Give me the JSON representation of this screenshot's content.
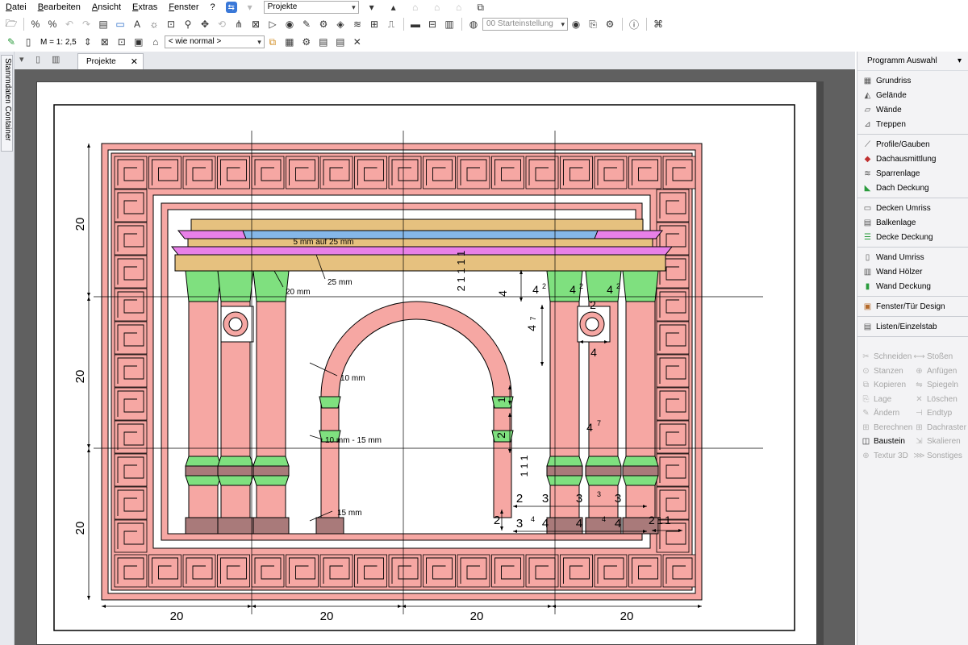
{
  "menu": {
    "items": [
      "Datei",
      "Bearbeiten",
      "Ansicht",
      "Extras",
      "Fenster",
      "?"
    ],
    "search_value": "Projekte"
  },
  "toolbar2": {
    "scale_label": "M = 1: 2,5",
    "line_style_value": "< wie normal >",
    "start_setting_value": "00 Starteinstellung"
  },
  "sidebar": {
    "stamm_label": "Stammdaten Container"
  },
  "tabs": {
    "active_label": "Projekte"
  },
  "right_panel": {
    "title": "Programm Auswahl",
    "groups": [
      [
        {
          "label": "Grundriss",
          "icon": "floorplan-icon"
        },
        {
          "label": "Gelände",
          "icon": "terrain-icon"
        },
        {
          "label": "Wände",
          "icon": "walls-icon"
        },
        {
          "label": "Treppen",
          "icon": "stairs-icon"
        }
      ],
      [
        {
          "label": "Profile/Gauben",
          "icon": "profile-icon"
        },
        {
          "label": "Dachausmittlung",
          "icon": "roof-icon"
        },
        {
          "label": "Sparrenlage",
          "icon": "rafter-icon"
        },
        {
          "label": "Dach Deckung",
          "icon": "roof-cover-icon"
        }
      ],
      [
        {
          "label": "Decken Umriss",
          "icon": "ceiling-outline-icon"
        },
        {
          "label": "Balkenlage",
          "icon": "beam-icon"
        },
        {
          "label": "Decke Deckung",
          "icon": "ceiling-cover-icon"
        }
      ],
      [
        {
          "label": "Wand Umriss",
          "icon": "wall-outline-icon"
        },
        {
          "label": "Wand Hölzer",
          "icon": "wall-timber-icon"
        },
        {
          "label": "Wand Deckung",
          "icon": "wall-cover-icon"
        }
      ],
      [
        {
          "label": "Fenster/Tür Design",
          "icon": "window-door-icon"
        }
      ],
      [
        {
          "label": "Listen/Einzelstab",
          "icon": "list-icon"
        }
      ]
    ],
    "tools": [
      {
        "label": "Schneiden",
        "active": false
      },
      {
        "label": "Stoßen",
        "active": false
      },
      {
        "label": "Stanzen",
        "active": false
      },
      {
        "label": "Anfügen",
        "active": false
      },
      {
        "label": "Kopieren",
        "active": false
      },
      {
        "label": "Spiegeln",
        "active": false
      },
      {
        "label": "Lage",
        "active": false
      },
      {
        "label": "Löschen",
        "active": false
      },
      {
        "label": "Ändern",
        "active": false
      },
      {
        "label": "Endtyp",
        "active": false
      },
      {
        "label": "Berechnen",
        "active": false
      },
      {
        "label": "Dachraster",
        "active": false
      },
      {
        "label": "Baustein",
        "active": true
      },
      {
        "label": "Skalieren",
        "active": false
      },
      {
        "label": "Textur 3D",
        "active": false
      },
      {
        "label": "Sonstiges",
        "active": false
      }
    ]
  },
  "drawing": {
    "labels": {
      "plank_top": "5 mm auf 25 mm",
      "beam_25": "25 mm",
      "beam_20": "20 mm",
      "arch": "10 mm",
      "arch_ring": "10 mm - 15 mm",
      "base": "15 mm"
    },
    "dims": {
      "frame_width_segments": [
        "20",
        "20",
        "20",
        "20"
      ],
      "frame_height_segments": [
        "20",
        "20",
        "20"
      ],
      "top_stack": "2 1 1 1 1",
      "column_capital_height": "4",
      "capitals": [
        "4",
        "4",
        "4"
      ],
      "capital_sup": "2",
      "circle": "2",
      "column_width": "4",
      "column_height_top": "4",
      "column_sup": "7",
      "column_mid_label": "4",
      "mid_sup": "7",
      "arch_ring_1": "1",
      "arch_ring_2": "2",
      "arch_ring_3": "2",
      "plinth_stack": "1 1 1",
      "foot_row": [
        "2",
        "3",
        "3",
        "3"
      ],
      "foot_sup": "3",
      "base_left": "2",
      "base_row": [
        "3",
        "4",
        "4",
        "4"
      ],
      "base_sup": "4",
      "base_right": [
        "2",
        "1",
        "1"
      ]
    }
  },
  "colors": {
    "pink": "#f6a7a3",
    "green": "#7fe07f",
    "dark_brown": "#a97a7a",
    "beam_tan": "#e6c17f",
    "plank_blue": "#85b7e8",
    "plank_magenta": "#e880e8",
    "canvas_gray": "#606060"
  }
}
